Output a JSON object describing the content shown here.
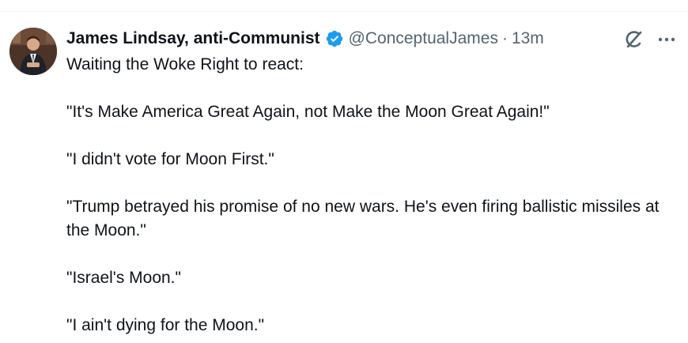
{
  "tweet": {
    "author": {
      "display_name": "James Lindsay, anti-Communist",
      "handle": "@ConceptualJames",
      "verified": true
    },
    "separator": "·",
    "time": "13m",
    "paragraphs": [
      "Waiting the Woke Right to react:",
      "\"It's Make America Great Again, not Make the Moon Great Again!\"",
      "\"I didn't vote for Moon First.\"",
      "\"Trump betrayed his promise of no new wars. He's even firing ballistic missiles at the Moon.\"",
      "\"Israel's Moon.\"",
      "\"I ain't dying for the Moon.\""
    ],
    "actions": {
      "grok_icon": "grok-icon",
      "more_icon": "more-options-icon"
    }
  },
  "colors": {
    "text_primary": "#0f1419",
    "text_secondary": "#536471",
    "verified_blue": "#1d9bf0",
    "divider": "#eff3f4"
  }
}
